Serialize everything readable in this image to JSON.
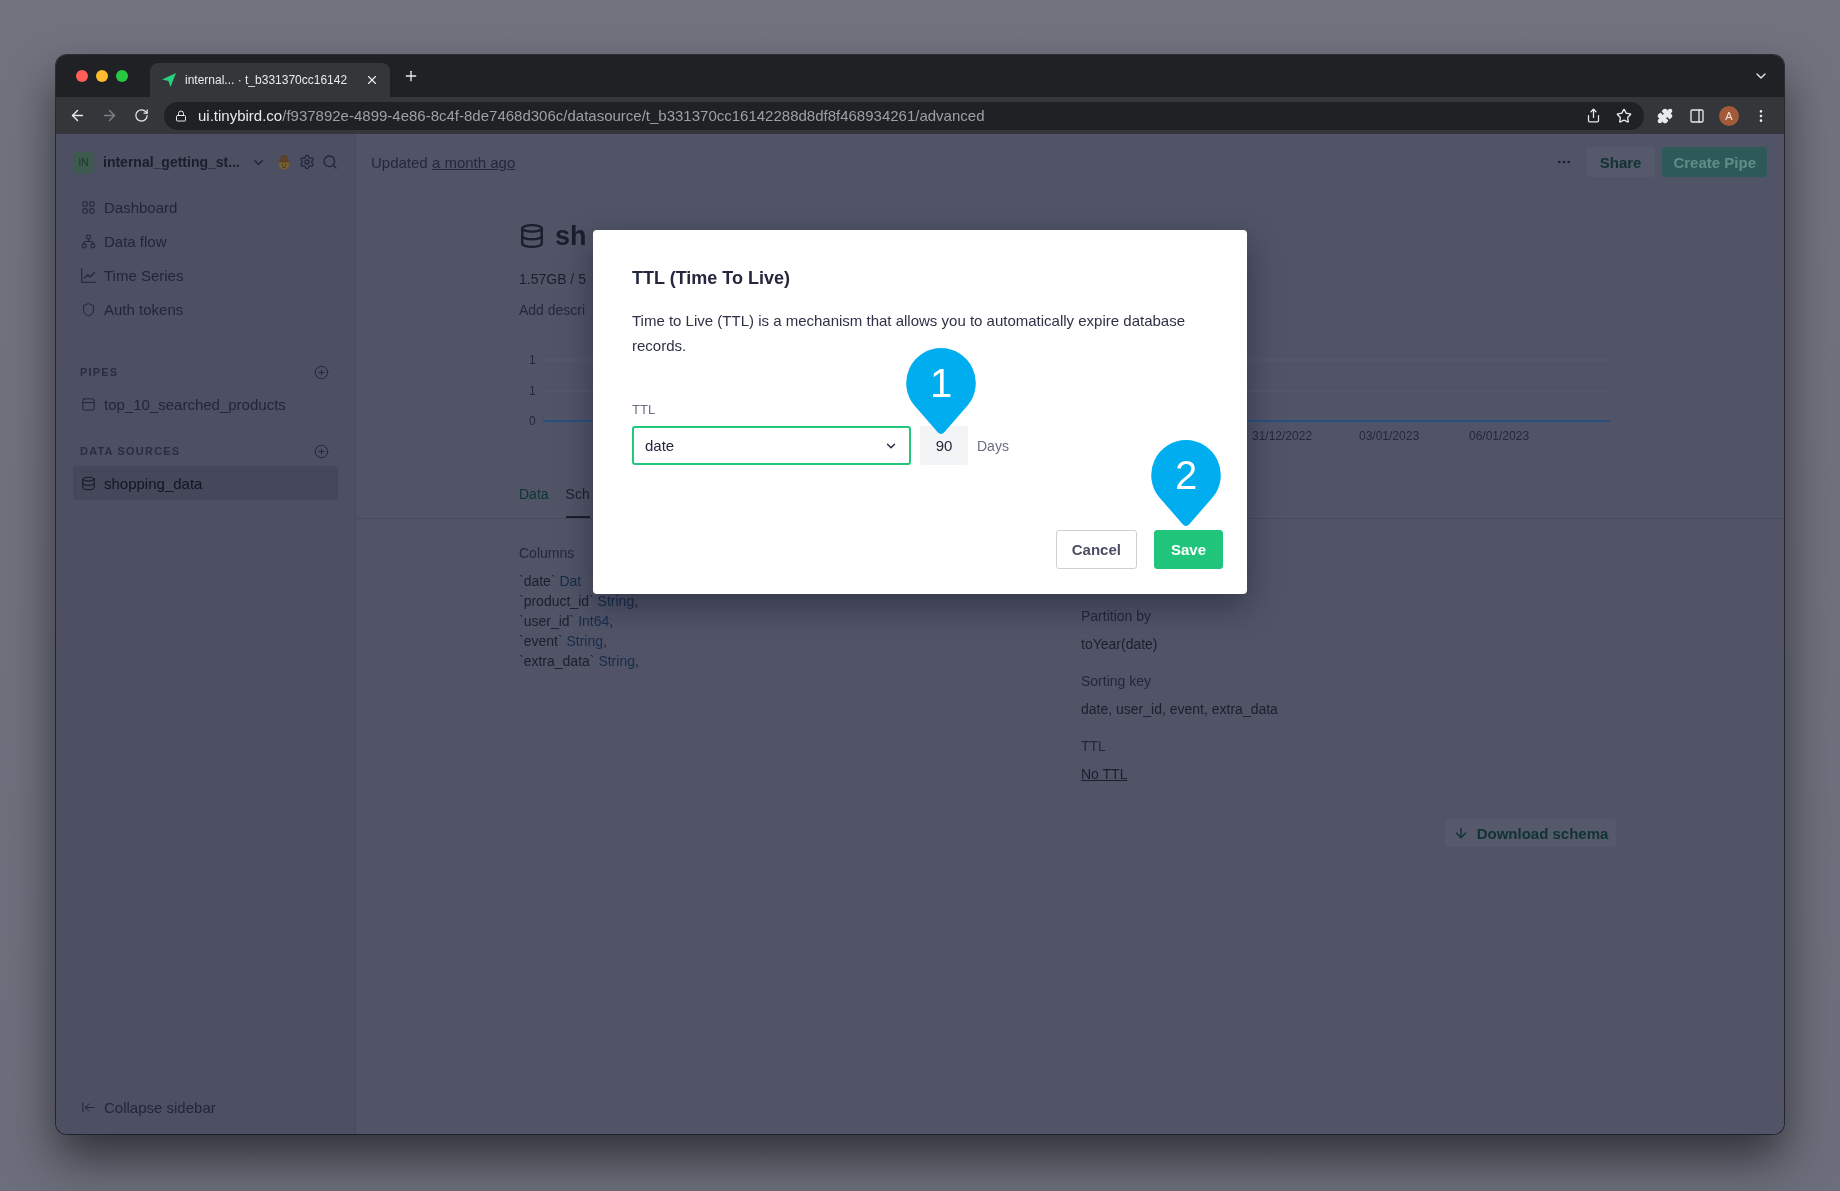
{
  "browser": {
    "tab_title": "internal... · t_b331370cc16142",
    "url": {
      "host": "ui.tinybird.co",
      "path": "/f937892e-4899-4e86-8c4f-8de7468d306c/datasource/t_b331370cc16142288d8df8f468934261/advanced"
    },
    "profile_initial": "A"
  },
  "sidebar": {
    "workspace": {
      "initials": "IN",
      "name": "internal_getting_st..."
    },
    "nav": [
      {
        "label": "Dashboard",
        "selected": false
      },
      {
        "label": "Data flow",
        "selected": false
      },
      {
        "label": "Time Series",
        "selected": false
      },
      {
        "label": "Auth tokens",
        "selected": false
      }
    ],
    "sections": [
      {
        "title": "PIPES",
        "items": [
          {
            "label": "top_10_searched_products",
            "kind": "pipe",
            "selected": false
          }
        ]
      },
      {
        "title": "DATA SOURCES",
        "items": [
          {
            "label": "shopping_data",
            "kind": "datasource",
            "selected": true
          }
        ]
      }
    ],
    "collapse_label": "Collapse sidebar"
  },
  "header": {
    "updated": {
      "text": "Updated",
      "link": "a month ago"
    },
    "buttons": [
      {
        "label": "Share",
        "kind": "secondary"
      },
      {
        "label": "Create Pipe",
        "kind": "primary"
      }
    ]
  },
  "datasource": {
    "title": "sh",
    "size": "1.57GB / 5",
    "description_prompt": "Add descri",
    "chart": {
      "y_labels": [
        "1",
        "1",
        "0"
      ],
      "x_labels": [
        "31/12/2022",
        "03/01/2023",
        "06/01/2023"
      ]
    },
    "tabs": [
      {
        "label": "Data",
        "selected": false
      },
      {
        "label": "Sch",
        "selected": true
      }
    ],
    "columns_title": "Columns",
    "columns": [
      {
        "name": "`date`",
        "type": "Dat"
      },
      {
        "name": "`product_id`",
        "type": "String",
        "suffix": ","
      },
      {
        "name": "`user_id`",
        "type": "Int64",
        "suffix": ","
      },
      {
        "name": "`event`",
        "type": "String",
        "suffix": ","
      },
      {
        "name": "`extra_data`",
        "type": "String",
        "suffix": ","
      }
    ],
    "settings": [
      {
        "label": "Partition by",
        "value": "toYear(date)",
        "kind": "text"
      },
      {
        "label": "Sorting key",
        "value": "date, user_id, event, extra_data",
        "kind": "text"
      },
      {
        "label": "TTL",
        "value": "No TTL",
        "kind": "link"
      }
    ],
    "download_label": "Download schema"
  },
  "dialog": {
    "title": "TTL (Time To Live)",
    "description": "Time to Live (TTL) is a mechanism that allows you to automatically expire database records.",
    "field_label": "TTL",
    "column_select": {
      "value": "date"
    },
    "days_input": {
      "value": "90"
    },
    "unit": "Days",
    "buttons": [
      {
        "label": "Cancel",
        "kind": "secondary"
      },
      {
        "label": "Save",
        "kind": "primary"
      }
    ]
  },
  "step_markers": [
    {
      "label": "1"
    },
    {
      "label": "2"
    }
  ]
}
